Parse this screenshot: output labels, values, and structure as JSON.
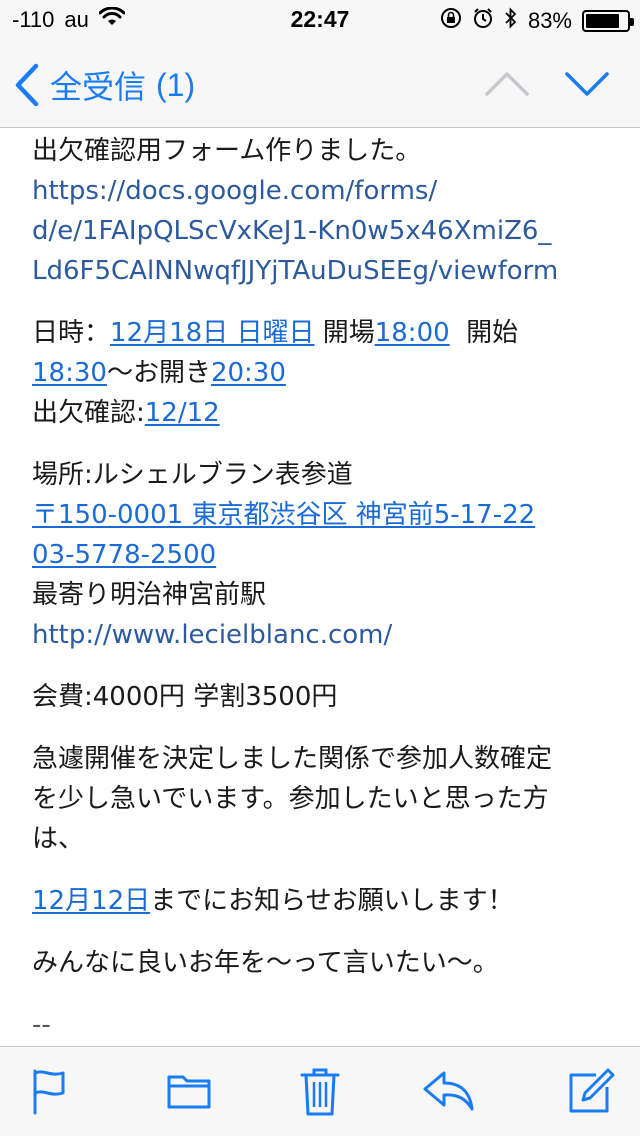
{
  "status_bar": {
    "signal": "-110",
    "carrier": "au",
    "time": "22:47",
    "battery_percent_text": "83%",
    "battery_level": 0.83
  },
  "nav": {
    "back_label": "全受信",
    "unread_count": "(1)"
  },
  "email": {
    "p1_line1": "出欠確認用フォーム作りました。",
    "p1_link1": "https://docs.google.com/forms/",
    "p1_link2": "d/e/1FAIpQLScVxKeJ1-Kn0w5x46XmiZ6_",
    "p1_link3": "Ld6F5CAlNNwqfJJYjTAuDuSEEg/viewform",
    "datetime_label": "日時：",
    "date_link": "12月18日 日曜日",
    "open_label": " 開場",
    "open_time": "18:00",
    "start_label": "  開始",
    "start_time": "18:30",
    "close_label": "〜お開き",
    "close_time": "20:30",
    "rsvp_label": "出欠確認:",
    "rsvp_date": "12/12",
    "venue": "場所:ルシェルブラン表参道",
    "address_link": "〒150-0001 東京都渋谷区 神宮前5-17-22",
    "phone_link": "03-5778-2500",
    "station": "最寄り明治神宮前駅",
    "venue_url": "http://www.lecielblanc.com/",
    "fee": "会費:4000円 学割3500円",
    "urgent_line1": "急遽開催を決定しました関係で参加人数確定",
    "urgent_line2": "を少し急いでいます。参加したいと思った方",
    "urgent_line3": "は、",
    "deadline_link": "12月12日",
    "deadline_text": "までにお知らせお願いします！",
    "closing": "みんなに良いお年を〜って言いたい〜。",
    "signature_sep": "--"
  },
  "colors": {
    "accent": "#1a7cf2",
    "link": "#1a6bd6",
    "bar_bg": "#f7f7f7",
    "disabled": "#c7c7cc"
  },
  "icons": {
    "nav": [
      "chevron-left-icon",
      "chevron-up-icon",
      "chevron-down-icon"
    ],
    "toolbar": [
      "flag-icon",
      "folder-icon",
      "trash-icon",
      "reply-icon",
      "compose-icon"
    ]
  }
}
